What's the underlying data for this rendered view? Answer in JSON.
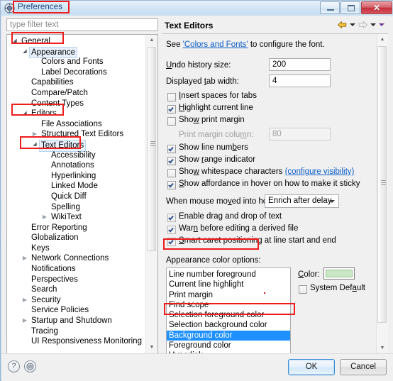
{
  "window": {
    "title": "Preferences",
    "icon": "preferences-icon",
    "buttons": {
      "minimize": "minimize-icon",
      "maximize": "maximize-icon",
      "close": "✕"
    }
  },
  "filter": {
    "placeholder": "type filter text",
    "value": ""
  },
  "tree": {
    "items": [
      {
        "label": "General",
        "indent": 0,
        "twisty": "▴",
        "selected": false
      },
      {
        "label": "Appearance",
        "indent": 1,
        "twisty": "▴",
        "selected": true
      },
      {
        "label": "Colors and Fonts",
        "indent": 2,
        "twisty": "",
        "selected": false
      },
      {
        "label": "Label Decorations",
        "indent": 2,
        "twisty": "",
        "selected": false
      },
      {
        "label": "Capabilities",
        "indent": 1,
        "twisty": "",
        "selected": false
      },
      {
        "label": "Compare/Patch",
        "indent": 1,
        "twisty": "",
        "selected": false
      },
      {
        "label": "Content Types",
        "indent": 1,
        "twisty": "",
        "selected": false
      },
      {
        "label": "Editors",
        "indent": 1,
        "twisty": "▴",
        "selected": false
      },
      {
        "label": "File Associations",
        "indent": 2,
        "twisty": "",
        "selected": false
      },
      {
        "label": "Structured Text Editors",
        "indent": 2,
        "twisty": "▸",
        "selected": false
      },
      {
        "label": "Text Editors",
        "indent": 2,
        "twisty": "▴",
        "selected": true
      },
      {
        "label": "Accessibility",
        "indent": 3,
        "twisty": "",
        "selected": false
      },
      {
        "label": "Annotations",
        "indent": 3,
        "twisty": "",
        "selected": false
      },
      {
        "label": "Hyperlinking",
        "indent": 3,
        "twisty": "",
        "selected": false
      },
      {
        "label": "Linked Mode",
        "indent": 3,
        "twisty": "",
        "selected": false
      },
      {
        "label": "Quick Diff",
        "indent": 3,
        "twisty": "",
        "selected": false
      },
      {
        "label": "Spelling",
        "indent": 3,
        "twisty": "",
        "selected": false
      },
      {
        "label": "WikiText",
        "indent": 3,
        "twisty": "▸",
        "selected": false
      },
      {
        "label": "Error Reporting",
        "indent": 1,
        "twisty": "",
        "selected": false
      },
      {
        "label": "Globalization",
        "indent": 1,
        "twisty": "",
        "selected": false
      },
      {
        "label": "Keys",
        "indent": 1,
        "twisty": "",
        "selected": false
      },
      {
        "label": "Network Connections",
        "indent": 1,
        "twisty": "▸",
        "selected": false
      },
      {
        "label": "Notifications",
        "indent": 1,
        "twisty": "",
        "selected": false
      },
      {
        "label": "Perspectives",
        "indent": 1,
        "twisty": "",
        "selected": false
      },
      {
        "label": "Search",
        "indent": 1,
        "twisty": "",
        "selected": false
      },
      {
        "label": "Security",
        "indent": 1,
        "twisty": "▸",
        "selected": false
      },
      {
        "label": "Service Policies",
        "indent": 1,
        "twisty": "",
        "selected": false
      },
      {
        "label": "Startup and Shutdown",
        "indent": 1,
        "twisty": "▸",
        "selected": false
      },
      {
        "label": "Tracing",
        "indent": 1,
        "twisty": "",
        "selected": false
      },
      {
        "label": "UI Responsiveness Monitoring",
        "indent": 1,
        "twisty": "",
        "selected": false
      }
    ]
  },
  "page": {
    "title": "Text Editors",
    "nav": {
      "back": "back-arrow-icon",
      "back_menu": "chevron-down-icon",
      "forward": "forward-arrow-icon",
      "forward_menu": "chevron-down-icon",
      "view_menu": "chevron-down-icon"
    },
    "intro_prefix": "See ",
    "intro_link": "'Colors and Fonts'",
    "intro_suffix": " to configure the font.",
    "fields": [
      {
        "label": "Undo history size:",
        "value": "200",
        "disabled": false
      },
      {
        "label": "Displayed tab width:",
        "value": "4",
        "disabled": false
      }
    ],
    "print_margin_label": "Print margin column:",
    "print_margin_value": "80",
    "checkboxes": [
      {
        "label": "Insert spaces for tabs",
        "checked": false
      },
      {
        "label": "Highlight current line",
        "checked": true
      },
      {
        "label": "Show print margin",
        "checked": false
      },
      {
        "label": "Show line numbers",
        "checked": true
      },
      {
        "label": "Show range indicator",
        "checked": true
      },
      {
        "label": "Show whitespace characters",
        "checked": false
      },
      {
        "label": "Show affordance in hover on how to make it sticky",
        "checked": true
      },
      {
        "label": "Enable drag and drop of text",
        "checked": true
      },
      {
        "label": "Warn before editing a derived file",
        "checked": true
      },
      {
        "label": "Smart caret positioning at line start and end",
        "checked": true
      }
    ],
    "whitespace_link": "(configure visibility)",
    "hover_label": "When mouse moved into hover:",
    "hover_value": "Enrich after delay",
    "hover_options": [
      "Enrich after delay"
    ],
    "appearance_label": "Appearance color options:",
    "color_options": [
      {
        "label": "Line number foreground",
        "selected": false
      },
      {
        "label": "Current line highlight",
        "selected": false
      },
      {
        "label": "Print margin",
        "selected": false
      },
      {
        "label": "Find scope",
        "selected": false
      },
      {
        "label": "Selection foreground color",
        "selected": false
      },
      {
        "label": "Selection background color",
        "selected": false
      },
      {
        "label": "Background color",
        "selected": true
      },
      {
        "label": "Foreground color",
        "selected": false
      },
      {
        "label": "Hyperlink",
        "selected": false
      }
    ],
    "color_label": "Color:",
    "color_value": "#c9e7c4",
    "system_default_label": "System Default",
    "system_default_checked": false
  },
  "footer": {
    "help_icon": "?",
    "restore_icon": "restore-defaults-icon",
    "ok": "OK",
    "cancel": "Cancel"
  },
  "annotations": {
    "accent": "#ef1c1c",
    "boxes": [
      "title-annotation",
      "general-annotation",
      "editors-annotation",
      "text-editors-annotation",
      "appearance-color-options-annotation",
      "background-color-annotation"
    ]
  }
}
